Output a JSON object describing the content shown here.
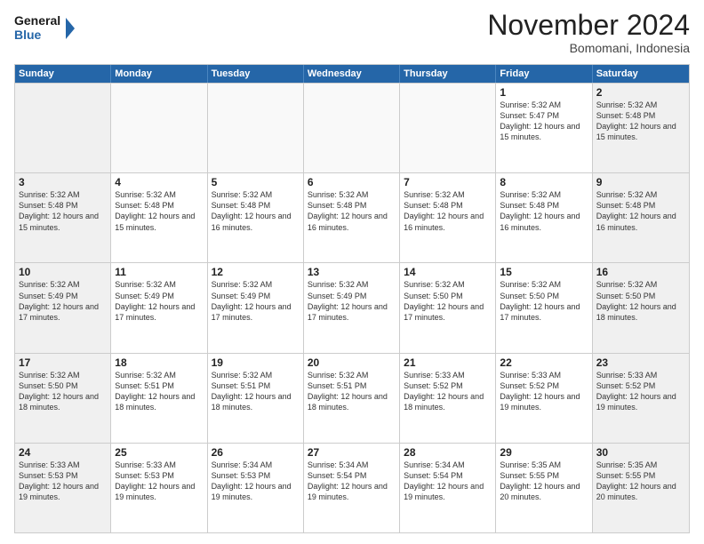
{
  "header": {
    "logo_line1": "General",
    "logo_line2": "Blue",
    "month_title": "November 2024",
    "location": "Bomomani, Indonesia"
  },
  "weekdays": [
    "Sunday",
    "Monday",
    "Tuesday",
    "Wednesday",
    "Thursday",
    "Friday",
    "Saturday"
  ],
  "rows": [
    [
      {
        "day": "",
        "info": ""
      },
      {
        "day": "",
        "info": ""
      },
      {
        "day": "",
        "info": ""
      },
      {
        "day": "",
        "info": ""
      },
      {
        "day": "",
        "info": ""
      },
      {
        "day": "1",
        "info": "Sunrise: 5:32 AM\nSunset: 5:47 PM\nDaylight: 12 hours and 15 minutes."
      },
      {
        "day": "2",
        "info": "Sunrise: 5:32 AM\nSunset: 5:48 PM\nDaylight: 12 hours and 15 minutes."
      }
    ],
    [
      {
        "day": "3",
        "info": "Sunrise: 5:32 AM\nSunset: 5:48 PM\nDaylight: 12 hours and 15 minutes."
      },
      {
        "day": "4",
        "info": "Sunrise: 5:32 AM\nSunset: 5:48 PM\nDaylight: 12 hours and 15 minutes."
      },
      {
        "day": "5",
        "info": "Sunrise: 5:32 AM\nSunset: 5:48 PM\nDaylight: 12 hours and 16 minutes."
      },
      {
        "day": "6",
        "info": "Sunrise: 5:32 AM\nSunset: 5:48 PM\nDaylight: 12 hours and 16 minutes."
      },
      {
        "day": "7",
        "info": "Sunrise: 5:32 AM\nSunset: 5:48 PM\nDaylight: 12 hours and 16 minutes."
      },
      {
        "day": "8",
        "info": "Sunrise: 5:32 AM\nSunset: 5:48 PM\nDaylight: 12 hours and 16 minutes."
      },
      {
        "day": "9",
        "info": "Sunrise: 5:32 AM\nSunset: 5:48 PM\nDaylight: 12 hours and 16 minutes."
      }
    ],
    [
      {
        "day": "10",
        "info": "Sunrise: 5:32 AM\nSunset: 5:49 PM\nDaylight: 12 hours and 17 minutes."
      },
      {
        "day": "11",
        "info": "Sunrise: 5:32 AM\nSunset: 5:49 PM\nDaylight: 12 hours and 17 minutes."
      },
      {
        "day": "12",
        "info": "Sunrise: 5:32 AM\nSunset: 5:49 PM\nDaylight: 12 hours and 17 minutes."
      },
      {
        "day": "13",
        "info": "Sunrise: 5:32 AM\nSunset: 5:49 PM\nDaylight: 12 hours and 17 minutes."
      },
      {
        "day": "14",
        "info": "Sunrise: 5:32 AM\nSunset: 5:50 PM\nDaylight: 12 hours and 17 minutes."
      },
      {
        "day": "15",
        "info": "Sunrise: 5:32 AM\nSunset: 5:50 PM\nDaylight: 12 hours and 17 minutes."
      },
      {
        "day": "16",
        "info": "Sunrise: 5:32 AM\nSunset: 5:50 PM\nDaylight: 12 hours and 18 minutes."
      }
    ],
    [
      {
        "day": "17",
        "info": "Sunrise: 5:32 AM\nSunset: 5:50 PM\nDaylight: 12 hours and 18 minutes."
      },
      {
        "day": "18",
        "info": "Sunrise: 5:32 AM\nSunset: 5:51 PM\nDaylight: 12 hours and 18 minutes."
      },
      {
        "day": "19",
        "info": "Sunrise: 5:32 AM\nSunset: 5:51 PM\nDaylight: 12 hours and 18 minutes."
      },
      {
        "day": "20",
        "info": "Sunrise: 5:32 AM\nSunset: 5:51 PM\nDaylight: 12 hours and 18 minutes."
      },
      {
        "day": "21",
        "info": "Sunrise: 5:33 AM\nSunset: 5:52 PM\nDaylight: 12 hours and 18 minutes."
      },
      {
        "day": "22",
        "info": "Sunrise: 5:33 AM\nSunset: 5:52 PM\nDaylight: 12 hours and 19 minutes."
      },
      {
        "day": "23",
        "info": "Sunrise: 5:33 AM\nSunset: 5:52 PM\nDaylight: 12 hours and 19 minutes."
      }
    ],
    [
      {
        "day": "24",
        "info": "Sunrise: 5:33 AM\nSunset: 5:53 PM\nDaylight: 12 hours and 19 minutes."
      },
      {
        "day": "25",
        "info": "Sunrise: 5:33 AM\nSunset: 5:53 PM\nDaylight: 12 hours and 19 minutes."
      },
      {
        "day": "26",
        "info": "Sunrise: 5:34 AM\nSunset: 5:53 PM\nDaylight: 12 hours and 19 minutes."
      },
      {
        "day": "27",
        "info": "Sunrise: 5:34 AM\nSunset: 5:54 PM\nDaylight: 12 hours and 19 minutes."
      },
      {
        "day": "28",
        "info": "Sunrise: 5:34 AM\nSunset: 5:54 PM\nDaylight: 12 hours and 19 minutes."
      },
      {
        "day": "29",
        "info": "Sunrise: 5:35 AM\nSunset: 5:55 PM\nDaylight: 12 hours and 20 minutes."
      },
      {
        "day": "30",
        "info": "Sunrise: 5:35 AM\nSunset: 5:55 PM\nDaylight: 12 hours and 20 minutes."
      }
    ]
  ]
}
